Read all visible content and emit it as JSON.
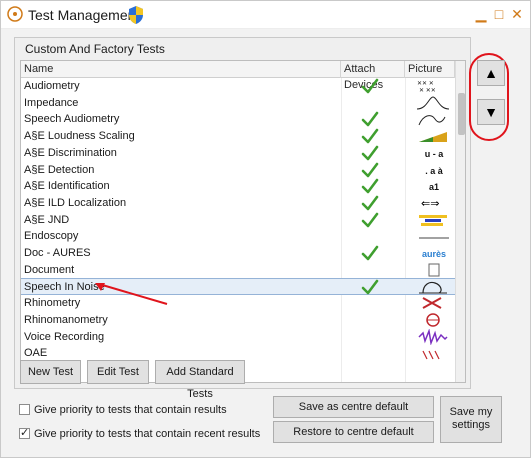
{
  "window": {
    "title": "Test Management"
  },
  "group": {
    "title": "Custom And Factory Tests"
  },
  "grid": {
    "columns": [
      "Name",
      "Attach Devices",
      "Picture"
    ],
    "rows": [
      {
        "name": "Audiometry",
        "attach": true,
        "picture": "audiometry-picture"
      },
      {
        "name": "Impedance",
        "attach": false,
        "picture": "impedance-picture"
      },
      {
        "name": "Speech Audiometry",
        "attach": true,
        "picture": "speech-audiometry-picture"
      },
      {
        "name": "A§E Loudness Scaling",
        "attach": true,
        "picture": "loudness-scaling-picture"
      },
      {
        "name": "A§E Discrimination",
        "attach": true,
        "picture": "discrimination-picture",
        "picture_text": "u - a"
      },
      {
        "name": "A§E Detection",
        "attach": true,
        "picture": "detection-picture",
        "picture_text": ". a à"
      },
      {
        "name": "A§E Identification",
        "attach": true,
        "picture": "identification-picture",
        "picture_text": "a1"
      },
      {
        "name": "A§E ILD Localization",
        "attach": true,
        "picture": "ild-localization-picture"
      },
      {
        "name": "A§E JND",
        "attach": true,
        "picture": "jnd-picture"
      },
      {
        "name": "Endoscopy",
        "attach": false,
        "picture": "endoscopy-picture"
      },
      {
        "name": "Doc - AURES",
        "attach": true,
        "picture": "aures-picture",
        "picture_text": "aurès"
      },
      {
        "name": "Document",
        "attach": false,
        "picture": "document-picture"
      },
      {
        "name": "Speech In Noise",
        "attach": true,
        "picture": "speech-in-noise-picture",
        "selected": true
      },
      {
        "name": "Rhinometry",
        "attach": false,
        "picture": "rhinometry-picture"
      },
      {
        "name": "Rhinomanometry",
        "attach": false,
        "picture": "rhinomanometry-picture"
      },
      {
        "name": "Voice Recording",
        "attach": false,
        "picture": "voice-recording-picture"
      },
      {
        "name": "OAE",
        "attach": false,
        "picture": "oae-picture"
      }
    ]
  },
  "buttons": {
    "new_test": "New Test",
    "edit_test": "Edit Test",
    "add_standard": "Add Standard Tests",
    "save_default": "Save as centre default",
    "restore_default": "Restore to centre default",
    "save_settings": "Save my settings"
  },
  "options": {
    "priority_results": {
      "label": "Give priority to tests that contain results",
      "checked": false
    },
    "priority_recent": {
      "label": "Give priority to tests that contain recent results",
      "checked": true
    }
  },
  "colors": {
    "check_green": "#3f9f2f",
    "annotation_red": "#e0141c",
    "window_controls": "#d07a18",
    "selection": "#e5eef8"
  }
}
